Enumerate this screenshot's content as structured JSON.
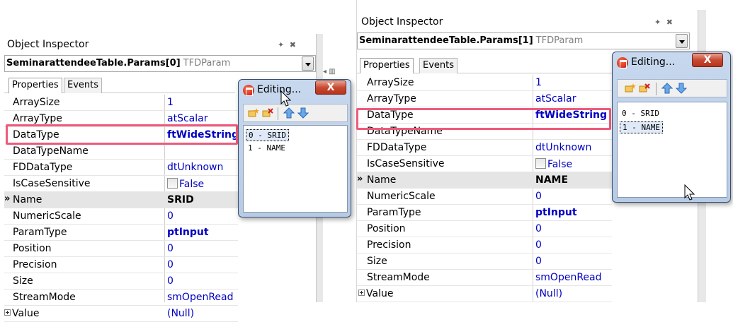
{
  "left_inspector": {
    "title": "Object Inspector",
    "pin_label": "✦ ✖",
    "component_name": "SeminarattendeeTable.Params[0]",
    "component_type": "TFDParam",
    "tabs": [
      {
        "label": "Properties"
      },
      {
        "label": "Events"
      }
    ],
    "selected_row_marker": "»",
    "properties": [
      {
        "name": "ArraySize",
        "value": "1"
      },
      {
        "name": "ArrayType",
        "value": "atScalar"
      },
      {
        "name": "DataType",
        "value": "ftWideString"
      },
      {
        "name": "DataTypeName",
        "value": ""
      },
      {
        "name": "FDDataType",
        "value": "dtUnknown"
      },
      {
        "name": "IsCaseSensitive",
        "value": "False"
      },
      {
        "name": "Name",
        "value": "SRID"
      },
      {
        "name": "NumericScale",
        "value": "0"
      },
      {
        "name": "ParamType",
        "value": "ptInput"
      },
      {
        "name": "Position",
        "value": "0"
      },
      {
        "name": "Precision",
        "value": "0"
      },
      {
        "name": "Size",
        "value": "0"
      },
      {
        "name": "StreamMode",
        "value": "smOpenRead"
      },
      {
        "name": "Value",
        "value": "(Null)"
      }
    ]
  },
  "left_editor": {
    "title": "Editing...",
    "close_label": "X",
    "items": [
      {
        "label": "0 - SRID"
      },
      {
        "label": "1 - NAME"
      }
    ]
  },
  "right_inspector": {
    "title": "Object Inspector",
    "pin_label": "✦ ✖",
    "component_name": "SeminarattendeeTable.Params[1]",
    "component_type": "TFDParam",
    "tabs": [
      {
        "label": "Properties"
      },
      {
        "label": "Events"
      }
    ],
    "selected_row_marker": "»",
    "properties": [
      {
        "name": "ArraySize",
        "value": "1"
      },
      {
        "name": "ArrayType",
        "value": "atScalar"
      },
      {
        "name": "DataType",
        "value": "ftWideString"
      },
      {
        "name": "DataTypeName",
        "value": ""
      },
      {
        "name": "FDDataType",
        "value": "dtUnknown"
      },
      {
        "name": "IsCaseSensitive",
        "value": "False"
      },
      {
        "name": "Name",
        "value": "NAME"
      },
      {
        "name": "NumericScale",
        "value": "0"
      },
      {
        "name": "ParamType",
        "value": "ptInput"
      },
      {
        "name": "Position",
        "value": "0"
      },
      {
        "name": "Precision",
        "value": "0"
      },
      {
        "name": "Size",
        "value": "0"
      },
      {
        "name": "StreamMode",
        "value": "smOpenRead"
      },
      {
        "name": "Value",
        "value": "(Null)"
      }
    ]
  },
  "right_editor": {
    "title": "Editing...",
    "close_label": "X",
    "items": [
      {
        "label": "0 - SRID"
      },
      {
        "label": "1 - NAME"
      }
    ]
  },
  "highlight_color": "#ef5a7a",
  "value_color": "#0000c0"
}
